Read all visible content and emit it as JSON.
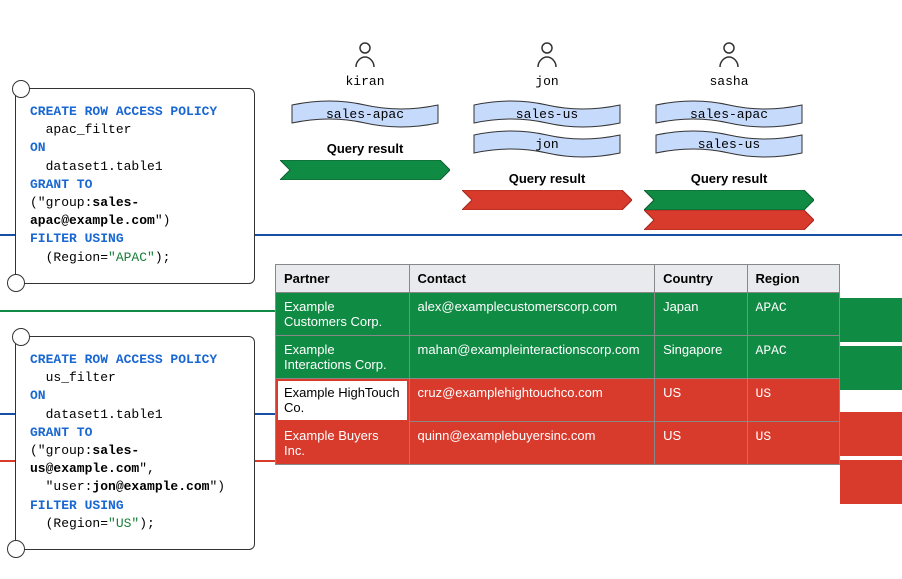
{
  "users": [
    {
      "name": "kiran",
      "groups": [
        "sales-apac"
      ],
      "result_stripes": [
        "green"
      ]
    },
    {
      "name": "jon",
      "groups": [
        "sales-us",
        "jon"
      ],
      "result_stripes": [
        "red"
      ]
    },
    {
      "name": "sasha",
      "groups": [
        "sales-apac",
        "sales-us"
      ],
      "result_stripes": [
        "green",
        "red"
      ]
    }
  ],
  "result_label": "Query result",
  "policies": {
    "apac": {
      "create": "CREATE ROW ACCESS POLICY",
      "name": "apac_filter",
      "on": "ON",
      "target": "dataset1.table1",
      "grant": "GRANT TO",
      "grant_open": "(\"group:",
      "principal": "sales-apac@example.com",
      "grant_close": "\")",
      "filter": "FILTER USING",
      "filter_expr_open": "(Region=",
      "filter_value": "\"APAC\"",
      "filter_expr_close": ");"
    },
    "us": {
      "create": "CREATE ROW ACCESS POLICY",
      "name": "us_filter",
      "on": "ON",
      "target": "dataset1.table1",
      "grant": "GRANT TO",
      "grant_open1": "(\"group:",
      "principal1": "sales-us@example.com",
      "grant_close1": "\",",
      "grant_open2": "\"user:",
      "principal2": "jon@example.com",
      "grant_close2": "\")",
      "filter": "FILTER USING",
      "filter_expr_open": "(Region=",
      "filter_value": "\"US\"",
      "filter_expr_close": ");"
    }
  },
  "table": {
    "headers": {
      "partner": "Partner",
      "contact": "Contact",
      "country": "Country",
      "region": "Region"
    },
    "rows": [
      {
        "cls": "green",
        "partner": "Example Customers Corp.",
        "contact": "alex@examplecustomerscorp.com",
        "country": "Japan",
        "region": "APAC"
      },
      {
        "cls": "green",
        "partner": "Example Interactions Corp.",
        "contact": "mahan@exampleinteractionscorp.com",
        "country": "Singapore",
        "region": "APAC"
      },
      {
        "cls": "red",
        "partner": "Example HighTouch Co.",
        "contact": "cruz@examplehightouchco.com",
        "country": "US",
        "region": "US",
        "partner_highlight": true
      },
      {
        "cls": "red",
        "partner": "Example Buyers Inc.",
        "contact": "quinn@examplebuyersinc.com",
        "country": "US",
        "region": "US"
      }
    ]
  },
  "colors": {
    "green": "#108b44",
    "red": "#d83a2c",
    "blue": "#174ea6",
    "flag_fill": "#c6dafc"
  }
}
